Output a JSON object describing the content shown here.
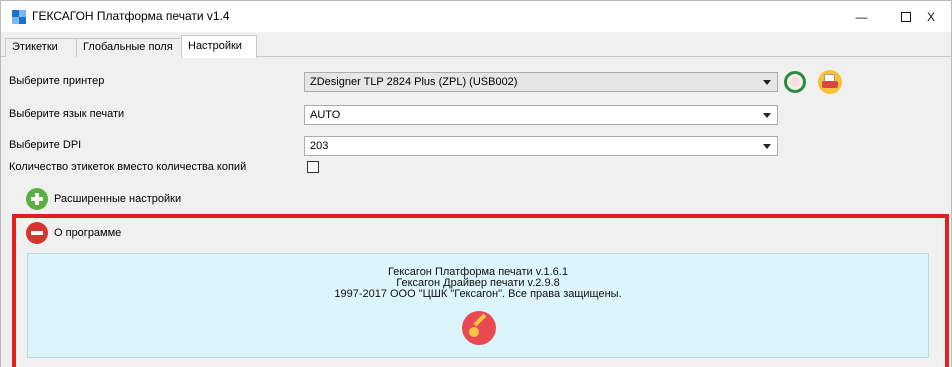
{
  "window": {
    "title": "ГЕКСАГОН Платформа печати  v1.4",
    "minimize": "—",
    "close": "X"
  },
  "tabs": [
    {
      "label": "Этикетки"
    },
    {
      "label": "Глобальные поля"
    },
    {
      "label": "Настройки",
      "active": true
    }
  ],
  "settings": {
    "printer_label": "Выберите принтер",
    "printer_value": "ZDesigner TLP 2824 Plus (ZPL) (USB002)",
    "language_label": "Выберите язык печати",
    "language_value": "AUTO",
    "dpi_label": "Выберите DPI",
    "dpi_value": "203",
    "label_count_label": "Количество этикеток вместо количества копий",
    "label_count_checked": false,
    "advanced_label": "Расширенные настройки",
    "about_label": "О программе"
  },
  "about": {
    "line1": "Гексагон Платформа печати v.1.6.1",
    "line2": "Гексагон Драйвер печати v.2.9.8",
    "line3": "1997-2017 ООО \"ЦШК \"Гексагон\". Все права защищены."
  },
  "icons": {
    "app_logo": "app-logo-icon",
    "refresh": "refresh-icon",
    "test_print": "printer-icon",
    "expand": "plus-icon",
    "collapse": "minus-icon",
    "license_key": "key-icon"
  },
  "colors": {
    "highlight_frame": "#e02020",
    "about_panel": "#dcf4fb",
    "plus_green": "#5bb043",
    "minus_red": "#d8342f"
  }
}
